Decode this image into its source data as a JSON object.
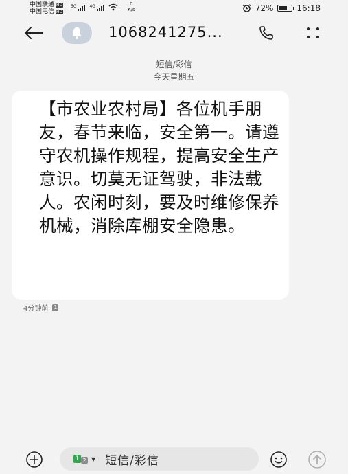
{
  "status_bar": {
    "carrier_1": "中国联通",
    "carrier_2": "中国电信",
    "hd_badge": "HD",
    "signal_1_label": "5G",
    "signal_2_label": "4G",
    "net_speed_value": "0",
    "net_speed_unit": "K/s",
    "battery_percent": "72%",
    "battery_level": 0.72,
    "time": "16:18"
  },
  "header": {
    "phone_number": "1068241275..."
  },
  "meta": {
    "message_type": "短信/彩信",
    "day_label": "今天星期五"
  },
  "message": {
    "text": "【市农业农村局】各位机手朋友，春节来临，安全第一。请遵守农机操作规程，提高安全生产意识。切莫无证驾驶，非法载人。农闲时刻，要及时维修保养机械，消除库棚安全隐患。",
    "time": "4分钟前",
    "sim_badge": "1"
  },
  "composer": {
    "sim_1": "1",
    "sim_2": "2",
    "placeholder": "短信/彩信"
  },
  "colors": {
    "background": "#f3f3f3",
    "bubble": "#ffffff",
    "sim_green": "#2fa84f"
  }
}
